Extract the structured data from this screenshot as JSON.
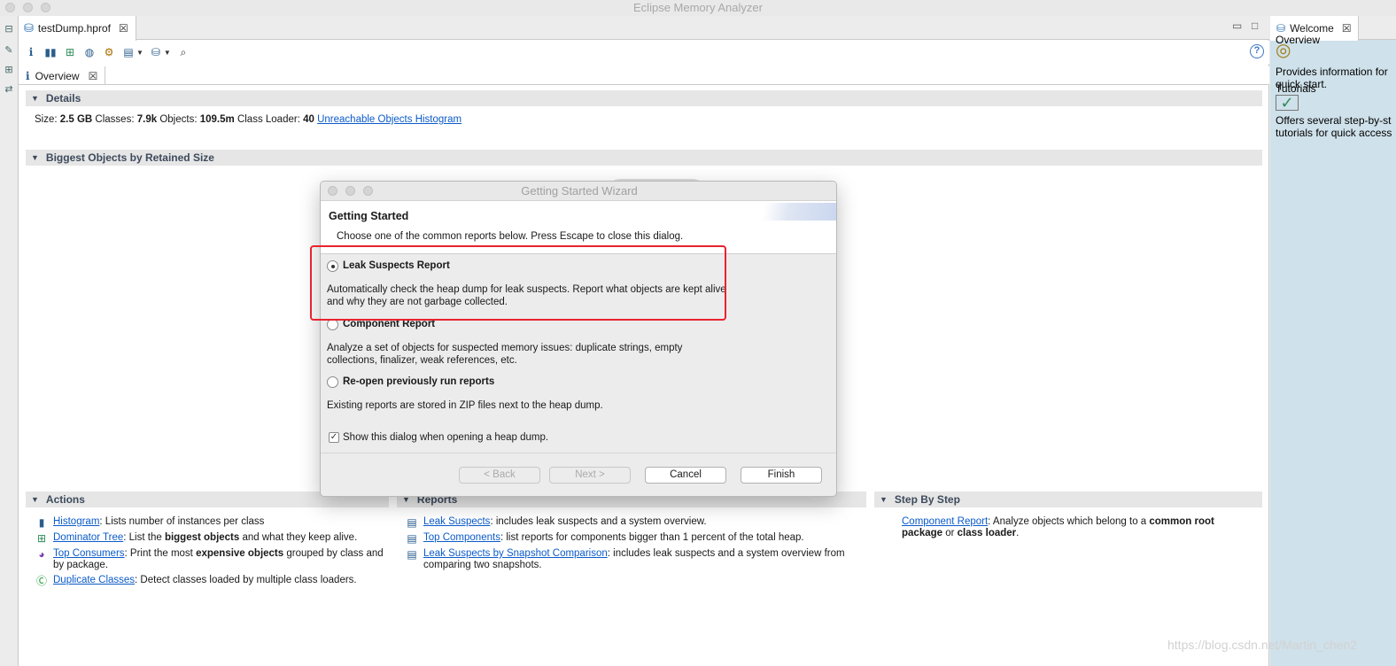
{
  "window": {
    "title": "Eclipse Memory Analyzer"
  },
  "editor": {
    "tab_label": "testDump.hprof",
    "subtab_label": "Overview"
  },
  "details": {
    "title": "Details",
    "size_label": "Size:",
    "size_value": "2.5 GB",
    "classes_label": "Classes:",
    "classes_value": "7.9k",
    "objects_label": "Objects:",
    "objects_value": "109.5m",
    "classloader_label": "Class Loader:",
    "classloader_value": "40",
    "unreachable_link": "Unreachable Objects Histogram"
  },
  "biggest": {
    "title": "Biggest Objects by Retained Size"
  },
  "actions": {
    "title": "Actions",
    "items": [
      {
        "link": "Histogram",
        "text": ": Lists number of instances per class"
      },
      {
        "link": "Dominator Tree",
        "text_pre": ": List the ",
        "bold": "biggest objects",
        "text_post": " and what they keep alive."
      },
      {
        "link": "Top Consumers",
        "text_pre": ": Print the most ",
        "bold": "expensive objects",
        "text_post": " grouped by class and by package."
      },
      {
        "link": "Duplicate Classes",
        "text": ": Detect classes loaded by multiple class loaders."
      }
    ]
  },
  "reports": {
    "title": "Reports",
    "items": [
      {
        "link": "Leak Suspects",
        "text": ": includes leak suspects and a system overview."
      },
      {
        "link": "Top Components",
        "text": ": list reports for components bigger than 1 percent of the total heap."
      },
      {
        "link": "Leak Suspects by Snapshot Comparison",
        "text": ": includes leak suspects and a system overview from comparing two snapshots."
      }
    ]
  },
  "stepbystep": {
    "title": "Step By Step",
    "link": "Component Report",
    "text_pre": ": Analyze objects which belong to a ",
    "bold1": "common root package",
    "text_mid": " or ",
    "bold2": "class loader",
    "text_post": "."
  },
  "welcome": {
    "tab_label": "Welcome",
    "overview_title": "Overview",
    "overview_text_1": "Provides information for",
    "overview_text_2": "quick start.",
    "tutorials_title": "Tutorials",
    "tutorials_text_1": "Offers several step-by-st",
    "tutorials_text_2": "tutorials for quick access"
  },
  "dialog": {
    "title": "Getting Started Wizard",
    "heading": "Getting Started",
    "subheading": "Choose one of the common reports below. Press Escape to close this dialog.",
    "options": [
      {
        "label": "Leak Suspects Report",
        "desc": "Automatically check the heap dump for leak suspects. Report what objects are kept alive and why they are not garbage collected."
      },
      {
        "label": "Component Report",
        "desc": "Analyze a set of objects for suspected memory issues: duplicate strings, empty collections, finalizer, weak references, etc."
      },
      {
        "label": "Re-open previously run reports",
        "desc": "Existing reports are stored in ZIP files next to the heap dump."
      }
    ],
    "selected_option": "Leak Suspects Report",
    "checkbox_label": "Show this dialog when opening a heap dump.",
    "checkbox_checked": true,
    "buttons": {
      "back": "< Back",
      "next": "Next >",
      "cancel": "Cancel",
      "finish": "Finish"
    }
  },
  "watermark": "https://blog.csdn.net/Martin_chen2",
  "colors": {
    "link": "#0b5bc9",
    "highlight": "#e8232e",
    "welcome_bg": "#cfe1ea",
    "section_head": "#e6e6e6"
  }
}
